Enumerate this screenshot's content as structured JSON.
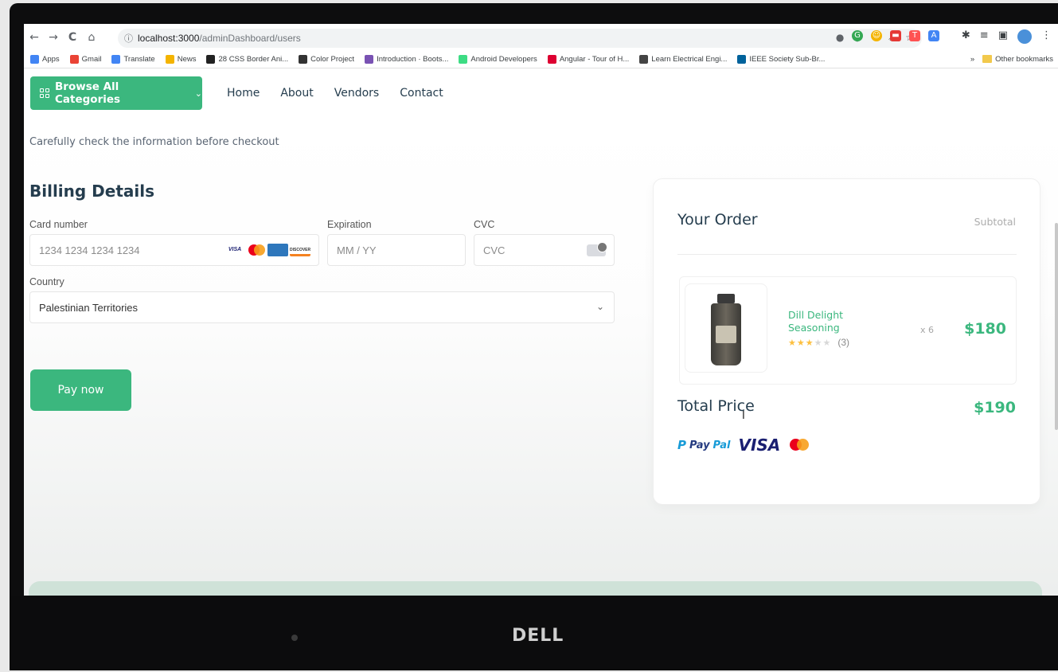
{
  "browser": {
    "nav_back": "←",
    "nav_forward": "→",
    "nav_reload": "C",
    "nav_home": "⌂",
    "url_host": "localhost:3000",
    "url_path": "/adminDashboard/users",
    "bookmarks": [
      {
        "label": "Apps",
        "color": "#4285f4"
      },
      {
        "label": "Gmail",
        "color": "#ea4335"
      },
      {
        "label": "Translate",
        "color": "#4285f4"
      },
      {
        "label": "News",
        "color": "#f4b400"
      },
      {
        "label": "28 CSS Border Ani...",
        "color": "#222222"
      },
      {
        "label": "Color Project",
        "color": "#333333"
      },
      {
        "label": "Introduction · Boots...",
        "color": "#7952b3"
      },
      {
        "label": "Android Developers",
        "color": "#3ddc84"
      },
      {
        "label": "Angular - Tour of H...",
        "color": "#dd0031"
      },
      {
        "label": "Learn Electrical Engi...",
        "color": "#444444"
      },
      {
        "label": "IEEE Society Sub-Br...",
        "color": "#00629b"
      }
    ],
    "bookmarks_more": "»",
    "other_bookmarks": "Other bookmarks"
  },
  "header": {
    "browse_label": "Browse All Categories",
    "nav": [
      "Home",
      "About",
      "Vendors",
      "Contact"
    ]
  },
  "checkout": {
    "hint": "Carefully check the information before checkout",
    "billing_title": "Billing Details",
    "card_number_label": "Card number",
    "card_number_placeholder": "1234 1234 1234 1234",
    "expiration_label": "Expiration",
    "expiration_placeholder": "MM / YY",
    "cvc_label": "CVC",
    "cvc_placeholder": "CVC",
    "country_label": "Country",
    "country_value": "Palestinian Territories",
    "card_brands": [
      "VISA",
      "",
      "",
      "DISCOVER"
    ],
    "pay_button": "Pay now"
  },
  "order": {
    "title": "Your Order",
    "subtotal_label": "Subtotal",
    "item": {
      "name": "Dill Delight Seasoning",
      "rating": 3,
      "rating_max": 5,
      "reviews": "(3)",
      "qty": "x 6",
      "price": "$180"
    },
    "total_label": "Total Price",
    "total_value": "$190",
    "payment_methods": [
      "PayPal",
      "VISA",
      "Mastercard"
    ]
  },
  "device": {
    "brand": "DELL"
  },
  "colors": {
    "accent": "#3bb77e",
    "heading": "#253d4e",
    "footer_band": "#cfe2d8"
  }
}
